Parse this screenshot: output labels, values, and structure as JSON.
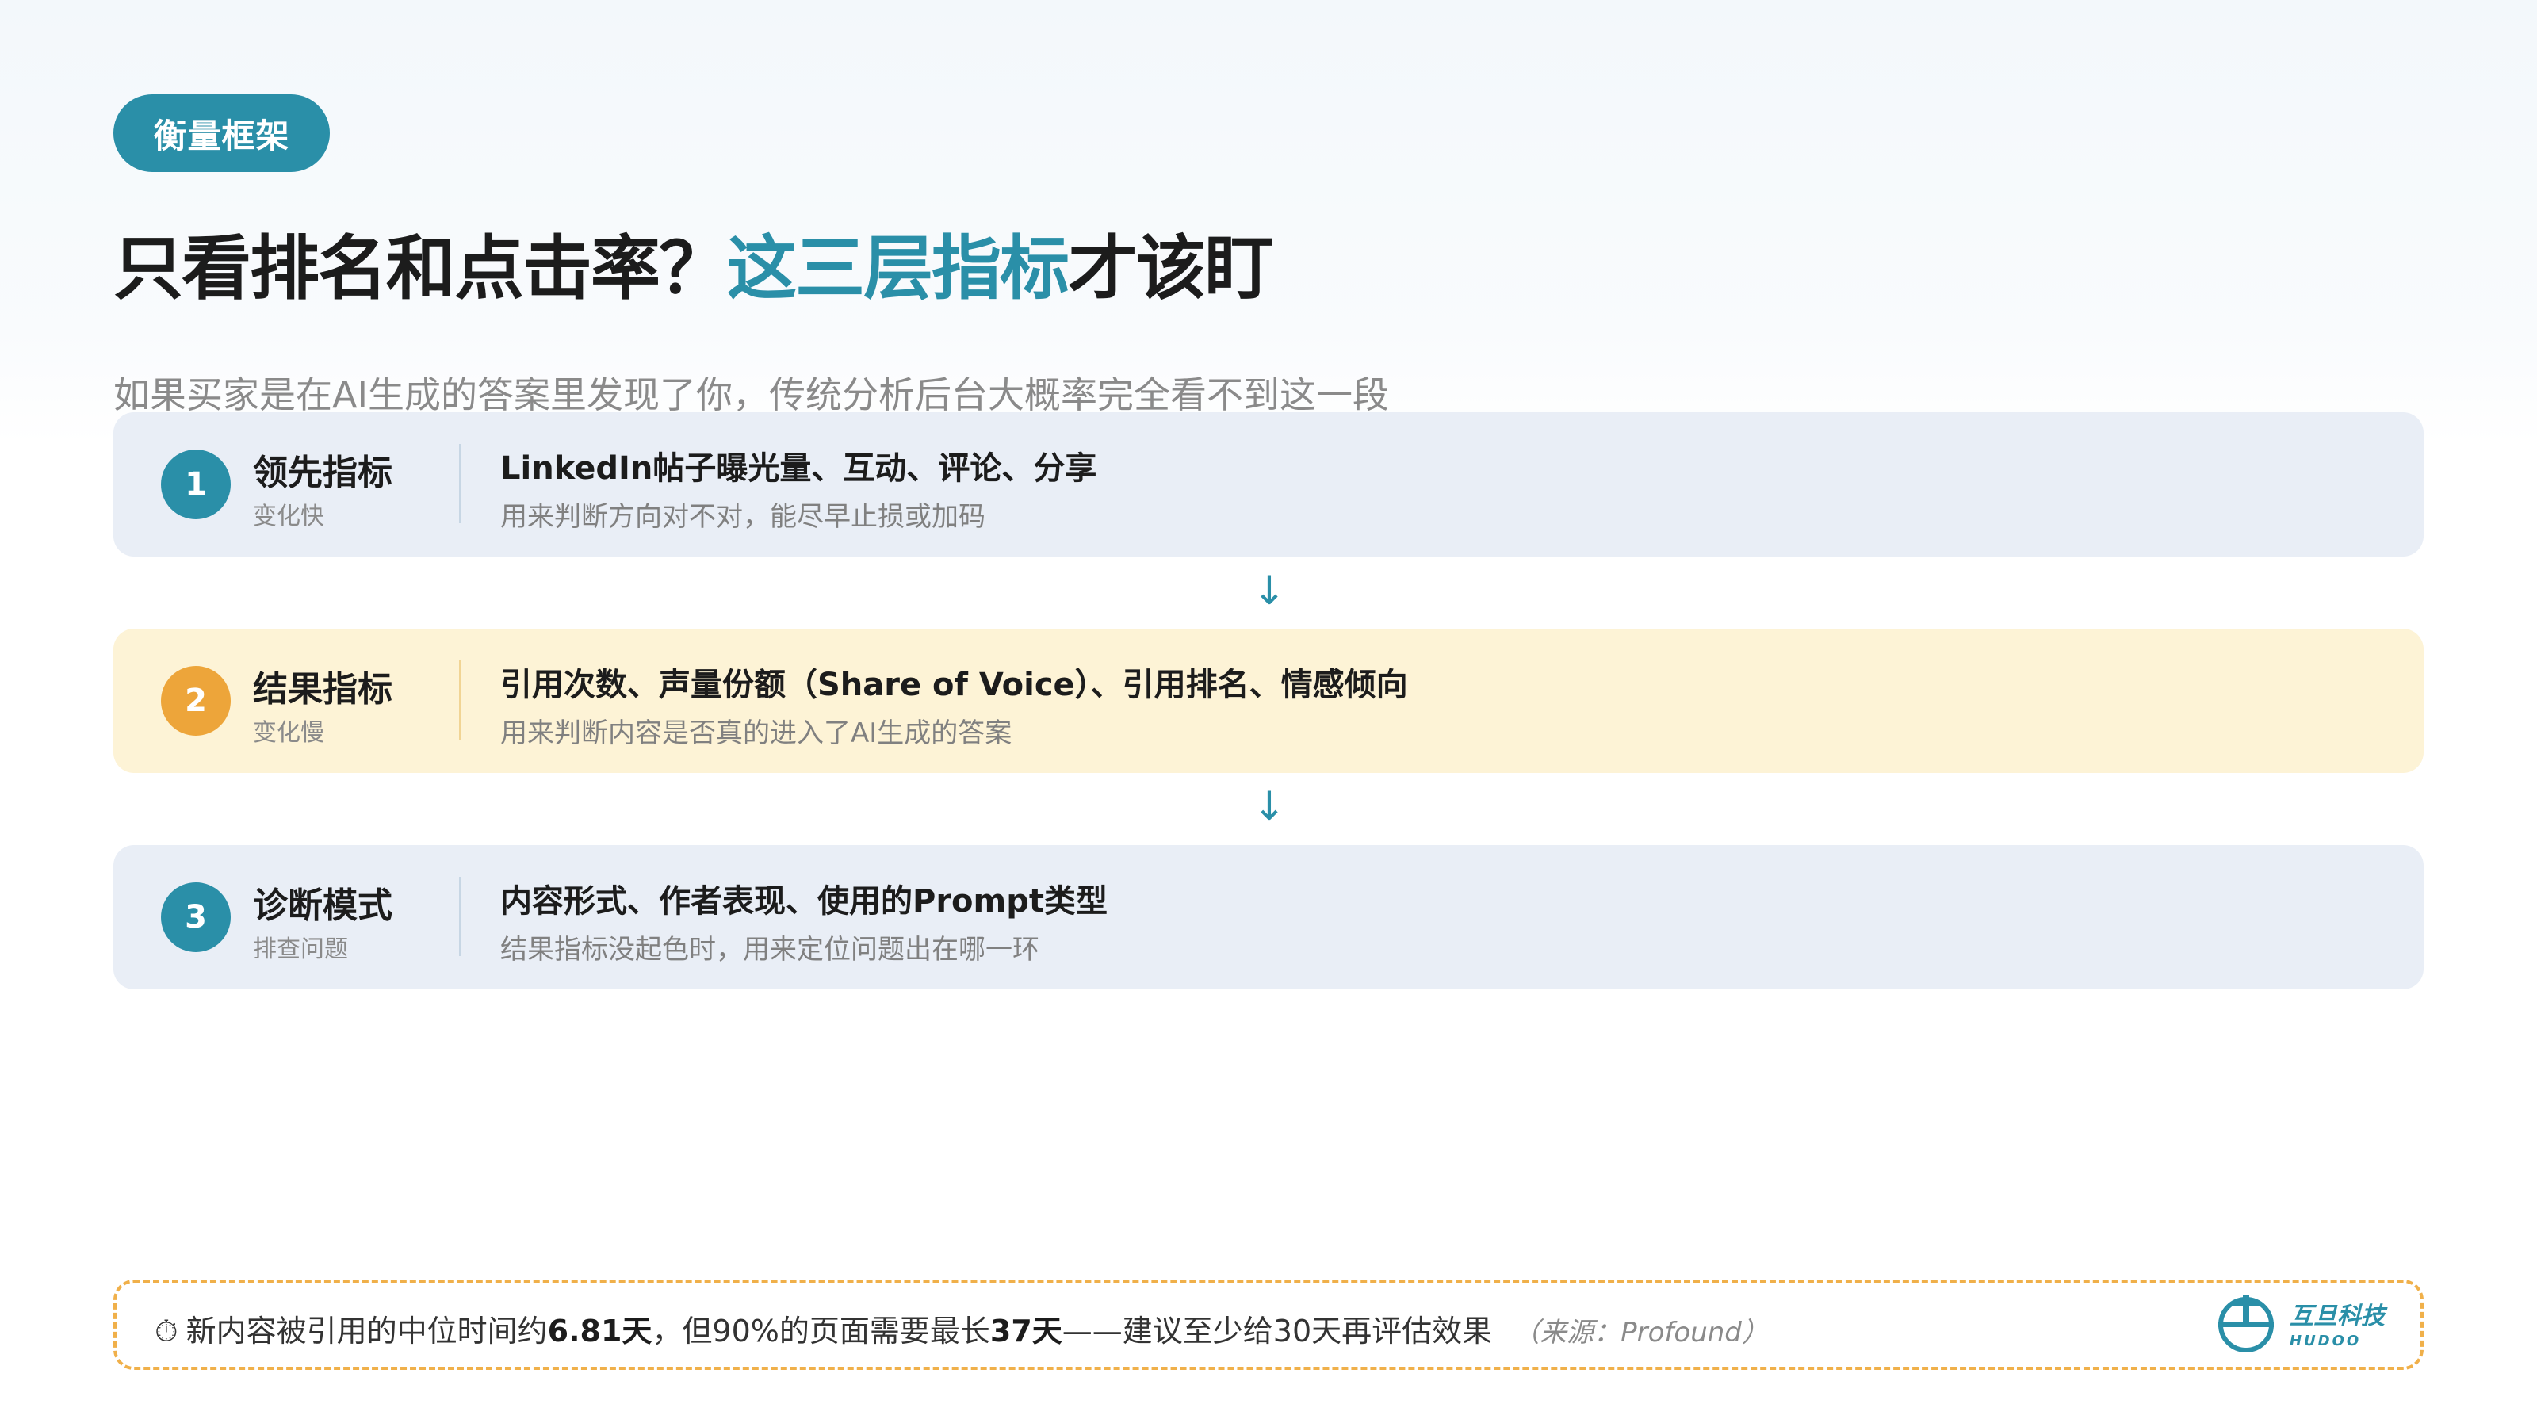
{
  "tag": "衡量框架",
  "title": {
    "part1": "只看排名和点击率？",
    "accent": "这三层指标",
    "part2": "才该盯"
  },
  "subtitle": "如果买家是在AI生成的答案里发现了你，传统分析后台大概率完全看不到这一段",
  "cards": [
    {
      "num": "1",
      "label": "领先指标",
      "sublabel": "变化快",
      "headline": "LinkedIn帖子曝光量、互动、评论、分享",
      "desc": "用来判断方向对不对，能尽早止损或加码"
    },
    {
      "num": "2",
      "label": "结果指标",
      "sublabel": "变化慢",
      "headline": "引用次数、声量份额（Share of Voice）、引用排名、情感倾向",
      "desc": "用来判断内容是否真的进入了AI生成的答案"
    },
    {
      "num": "3",
      "label": "诊断模式",
      "sublabel": "排查问题",
      "headline": "内容形式、作者表现、使用的Prompt类型",
      "desc": "结果指标没起色时，用来定位问题出在哪一环"
    }
  ],
  "arrow": "↓",
  "note": {
    "icon": "⏱",
    "t1": "新内容被引用的中位时间约",
    "b1": "6.81天",
    "t2": "，但90%的页面需要最长",
    "b2": "37天",
    "t3": "——建议至少给30天再评估效果",
    "source": "（来源：Profound）"
  },
  "logo": {
    "name": "互旦科技",
    "sub": "HUDOO"
  },
  "colors": {
    "accent": "#2a8fa8",
    "orange": "#eda53a",
    "card_blue": "#e9eef6",
    "card_yellow": "#fdf3d6"
  }
}
